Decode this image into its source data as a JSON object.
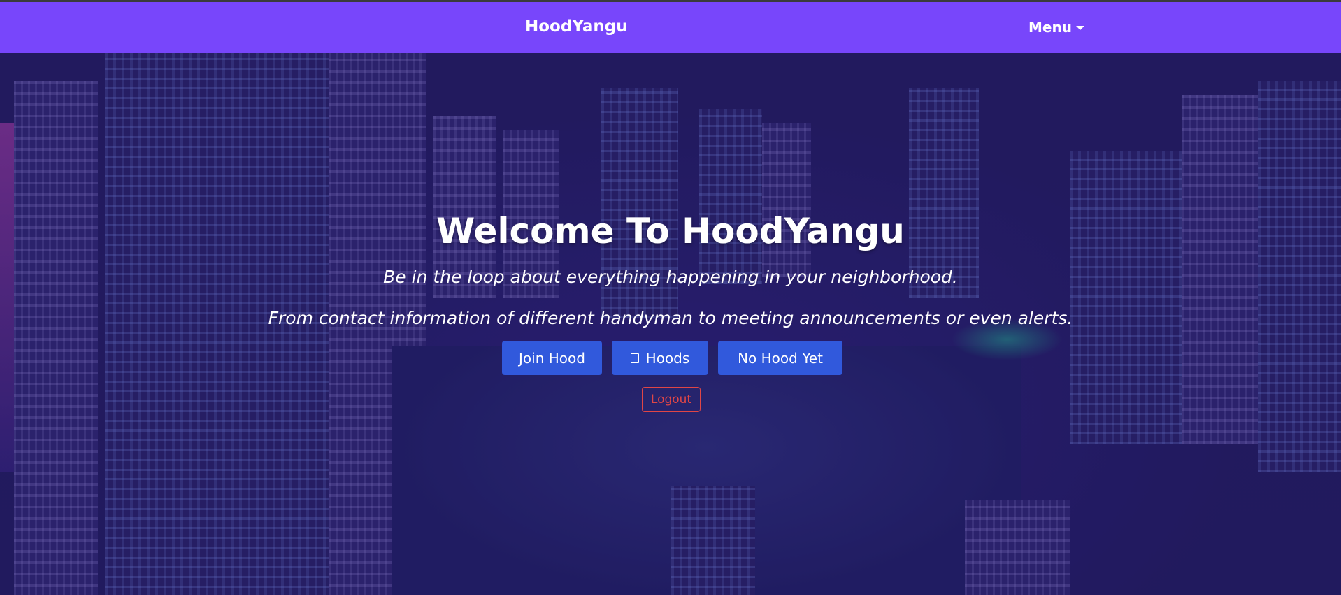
{
  "navbar": {
    "brand": "HoodYangu",
    "menu_label": "Menu",
    "background_color": "#7846fb"
  },
  "hero": {
    "title": "Welcome To HoodYangu",
    "tagline": "Be in the loop about everything happening in your neighborhood.",
    "subtagline": "From contact information of different handyman to meeting announcements or even alerts.",
    "buttons": [
      {
        "label": "Join Hood",
        "icon": ""
      },
      {
        "label": "Hoods",
        "icon": "grid-icon"
      },
      {
        "label": "No Hood Yet",
        "icon": ""
      }
    ],
    "logout_label": "Logout",
    "button_color": "#3159dc",
    "logout_color": "#e04646"
  }
}
